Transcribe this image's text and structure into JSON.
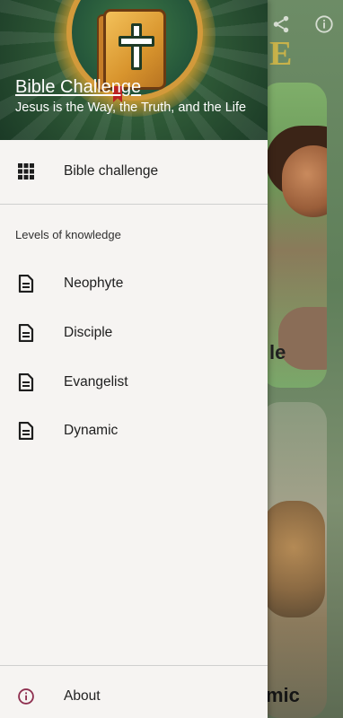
{
  "background": {
    "share_icon": "share-icon",
    "info_icon": "info-icon",
    "card1_partial_text": "le",
    "card2_partial_text": "mic",
    "title_partial_letter": "E"
  },
  "drawer": {
    "header": {
      "title": "Bible Challenge",
      "subtitle": "Jesus is the Way, the Truth, and the Life"
    },
    "top_item": {
      "label": "Bible challenge",
      "icon": "grid-icon"
    },
    "section_label": "Levels of knowledge",
    "levels": [
      {
        "label": "Neophyte",
        "icon": "document-icon"
      },
      {
        "label": "Disciple",
        "icon": "document-icon"
      },
      {
        "label": "Evangelist",
        "icon": "document-icon"
      },
      {
        "label": "Dynamic",
        "icon": "document-icon"
      }
    ],
    "about": {
      "label": "About",
      "icon": "info-icon",
      "icon_color": "#8e2f4f"
    }
  }
}
